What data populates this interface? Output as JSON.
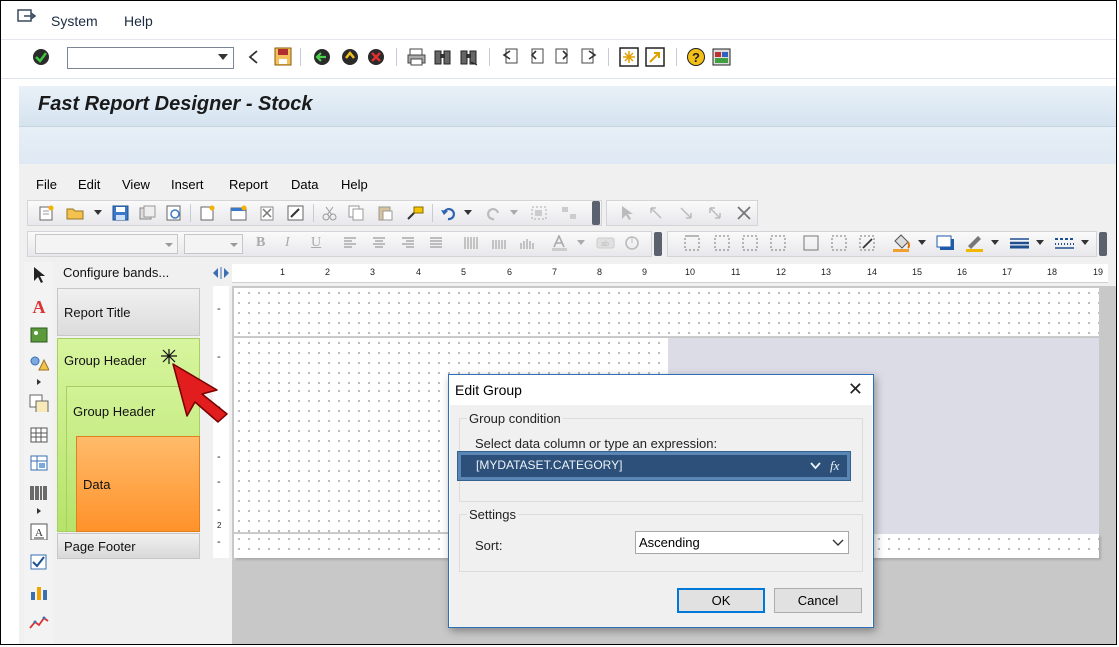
{
  "sap": {
    "menu": [
      "System",
      "Help"
    ],
    "title": "Fast Report Designer - Stock"
  },
  "designer": {
    "menu": [
      "File",
      "Edit",
      "View",
      "Insert",
      "Report",
      "Data",
      "Help"
    ],
    "configure_bands": "Configure bands...",
    "bands": {
      "report_title": "Report Title",
      "group_header_1": "Group Header",
      "group_header_2": "Group Header",
      "data": "Data",
      "page_footer": "Page Footer"
    },
    "ruler_ticks": [
      "1",
      "2",
      "3",
      "4",
      "5",
      "6",
      "7",
      "8",
      "9",
      "10",
      "11",
      "12",
      "13",
      "14",
      "15",
      "16",
      "17",
      "18",
      "19"
    ],
    "vruler_dash": "-",
    "vruler_two": "2"
  },
  "dialog": {
    "title": "Edit Group",
    "close_glyph": "✕",
    "group_condition": {
      "legend": "Group condition",
      "prompt": "Select data column or type an expression:",
      "value": "[MYDATASET.CATEGORY]"
    },
    "settings": {
      "legend": "Settings",
      "sort_label": "Sort:",
      "sort_value": "Ascending"
    },
    "ok_label": "OK",
    "cancel_label": "Cancel"
  },
  "colors": {
    "band_green": "#b6e36a",
    "band_orange": "#ff9a2e",
    "dialog_border": "#2f6fb5",
    "expression_highlight": "#2b4f7a",
    "cursor_red": "#e11d1d"
  },
  "icons": [
    "check-icon",
    "back-icon",
    "save-icon",
    "go-back-icon",
    "exit-icon",
    "cancel-icon",
    "print-icon",
    "find-icon",
    "find-next-icon",
    "first-page-icon",
    "prev-page-icon",
    "next-page-icon",
    "last-page-icon",
    "new-session-icon",
    "shortcut-icon",
    "help-icon",
    "customize-layout-icon"
  ]
}
